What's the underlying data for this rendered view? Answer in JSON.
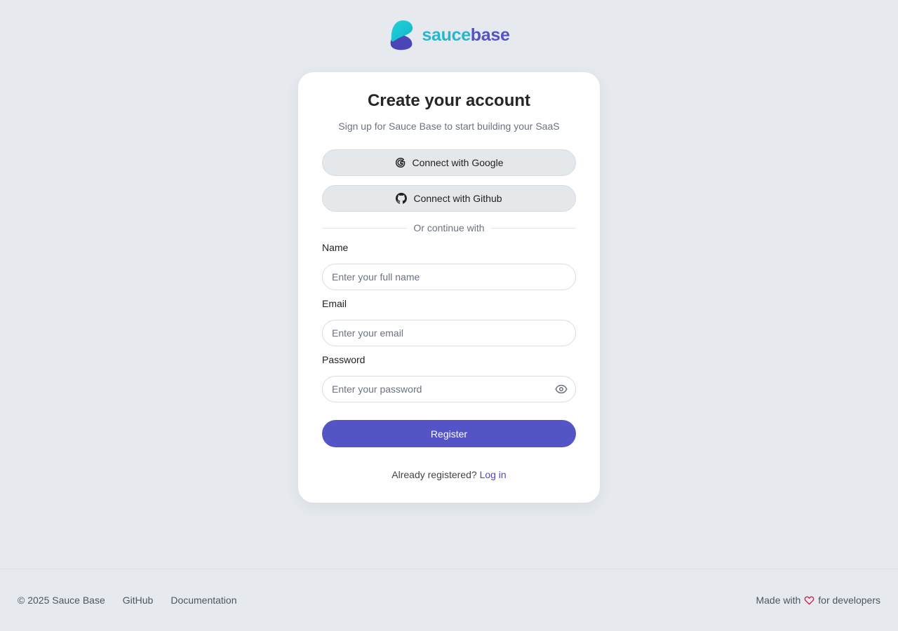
{
  "brand": {
    "name_part1": "sauce",
    "name_part2": "base",
    "color_primary": "#22b8cf",
    "color_secondary": "#5452c6"
  },
  "card": {
    "title": "Create your account",
    "subtitle": "Sign up for Sauce Base to start building your SaaS",
    "google_button": "Connect with Google",
    "github_button": "Connect with Github",
    "divider_text": "Or continue with",
    "name_label": "Name",
    "name_placeholder": "Enter your full name",
    "email_label": "Email",
    "email_placeholder": "Enter your email",
    "password_label": "Password",
    "password_placeholder": "Enter your password",
    "register_button": "Register",
    "already_registered": "Already registered?",
    "login_link": "Log in"
  },
  "footer": {
    "copyright": "© 2025 Sauce Base",
    "github_link": "GitHub",
    "docs_link": "Documentation",
    "made_with": "Made with",
    "for_developers": "for developers"
  },
  "icons": {
    "google": "google-icon",
    "github": "github-icon",
    "password_toggle": "eye-icon",
    "heart": "heart-icon"
  },
  "colors": {
    "background": "#e6eaee",
    "accent": "#5454c6",
    "link": "#4f46c5",
    "heart": "#e11d48"
  }
}
